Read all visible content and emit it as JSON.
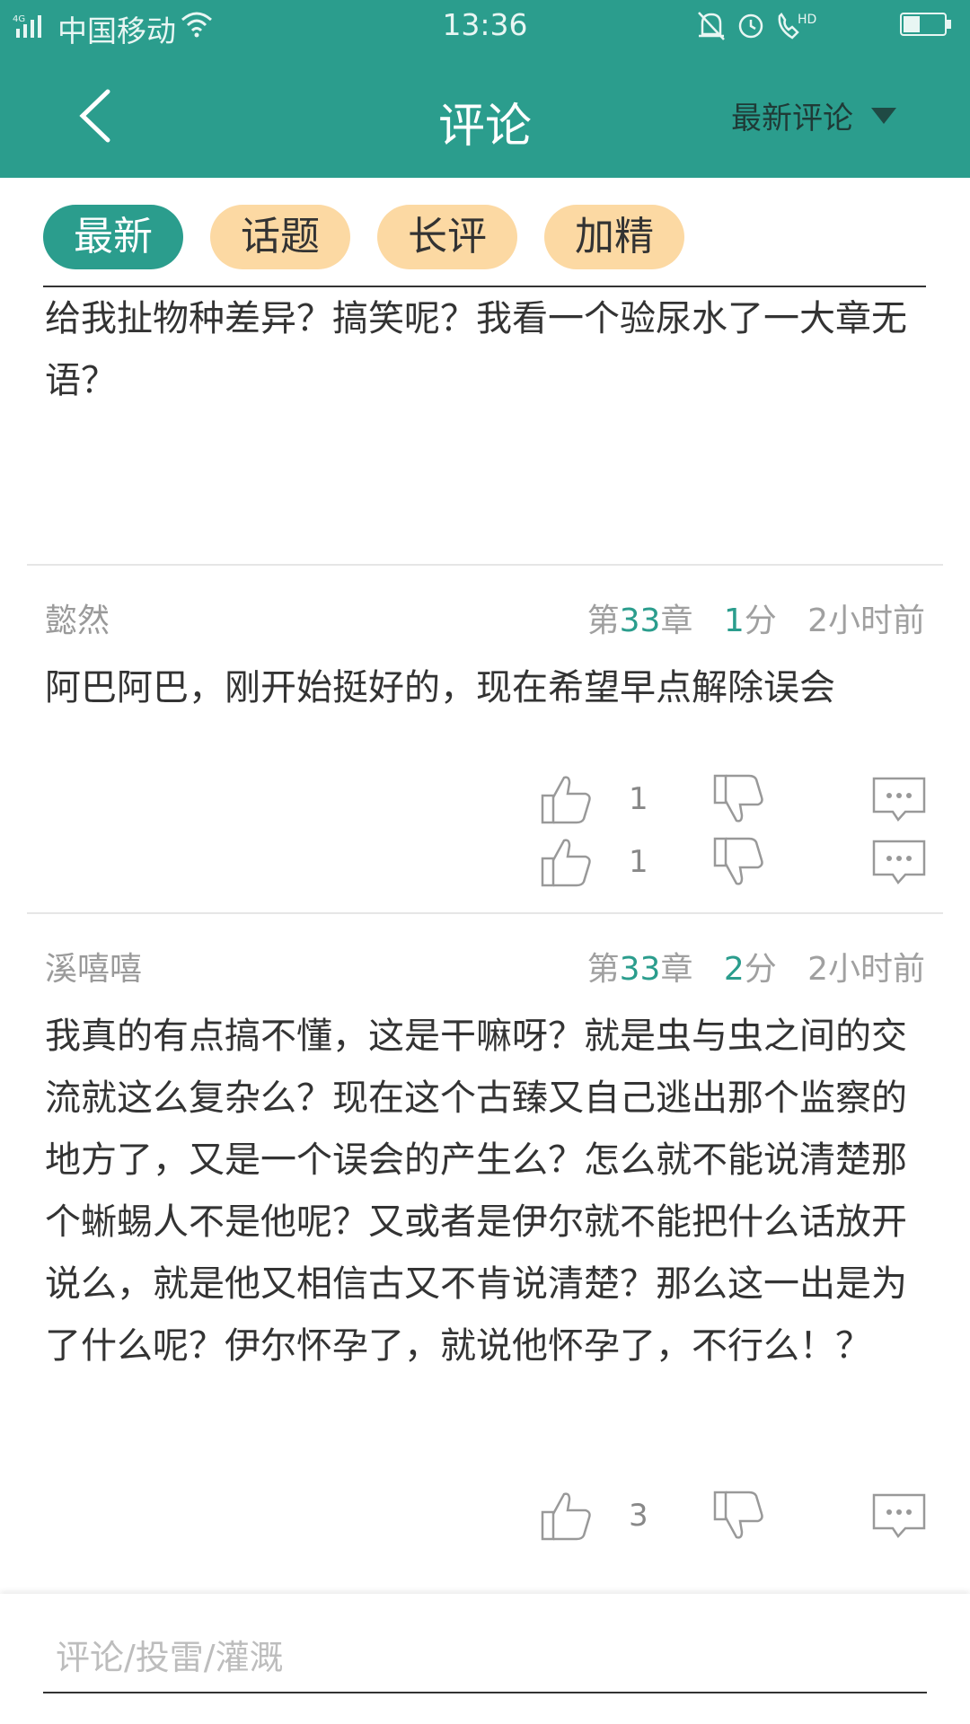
{
  "status_bar": {
    "network": "4G",
    "carrier": "中国移动",
    "time": "13:36",
    "hd_label": "HD"
  },
  "header": {
    "title": "评论",
    "sort_label": "最新评论"
  },
  "tabs": [
    {
      "label": "最新",
      "active": true
    },
    {
      "label": "话题",
      "active": false
    },
    {
      "label": "长评",
      "active": false
    },
    {
      "label": "加精",
      "active": false
    }
  ],
  "comments": [
    {
      "body": "子！雌虫都可以在他的监星态复到复说了，你还在这里给我扯物种差异？搞笑呢？我看一个验尿水了一大章无语？",
      "likes": "1"
    },
    {
      "user": "懿然",
      "chapter_prefix": "第",
      "chapter_num": "33",
      "chapter_suffix": "章",
      "score_num": "1",
      "score_suffix": "分",
      "time": "2小时前",
      "body": "阿巴阿巴，刚开始挺好的，现在希望早点解除误会",
      "likes": "1"
    },
    {
      "user": "溪嘻嘻",
      "chapter_prefix": "第",
      "chapter_num": "33",
      "chapter_suffix": "章",
      "score_num": "2",
      "score_suffix": "分",
      "time": "2小时前",
      "body": "我真的有点搞不懂，这是干嘛呀？就是虫与虫之间的交流就这么复杂么？现在这个古臻又自己逃出那个监察的地方了，又是一个误会的产生么？怎么就不能说清楚那个蜥蜴人不是他呢？又或者是伊尔就不能把什么话放开说么，就是他又相信古又不肯说清楚？那么这一出是为了什么呢？伊尔怀孕了，就说他怀孕了，不行么！？",
      "likes": "3"
    }
  ],
  "input": {
    "placeholder": "评论/投雷/灌溉"
  }
}
